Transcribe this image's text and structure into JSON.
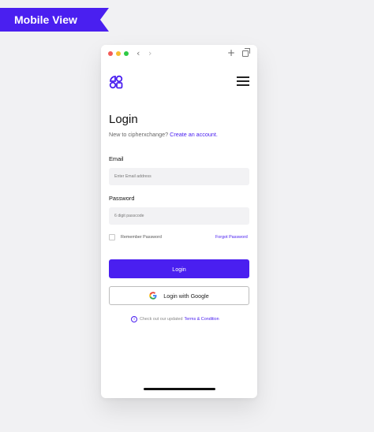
{
  "badge": {
    "label": "Mobile View"
  },
  "browser": {
    "back_icon": "‹",
    "forward_icon": "›",
    "new_tab_icon": "+"
  },
  "login": {
    "title": "Login",
    "subtitle_prefix": "New to cipherxchange?",
    "create_account_link": "Create an account.",
    "email_label": "Email",
    "email_placeholder": "Enter Email address",
    "password_label": "Password",
    "password_placeholder": "6 digit passcode",
    "remember_label": "Remember Password",
    "forgot_link": "Forgot Password",
    "login_button": "Login",
    "google_button": "Login with Google",
    "terms_prefix": "Check out our updated",
    "terms_link": "Terms & Condition"
  },
  "colors": {
    "accent": "#4a1ff0",
    "background": "#f1f1f3",
    "field_bg": "#f2f2f4"
  }
}
